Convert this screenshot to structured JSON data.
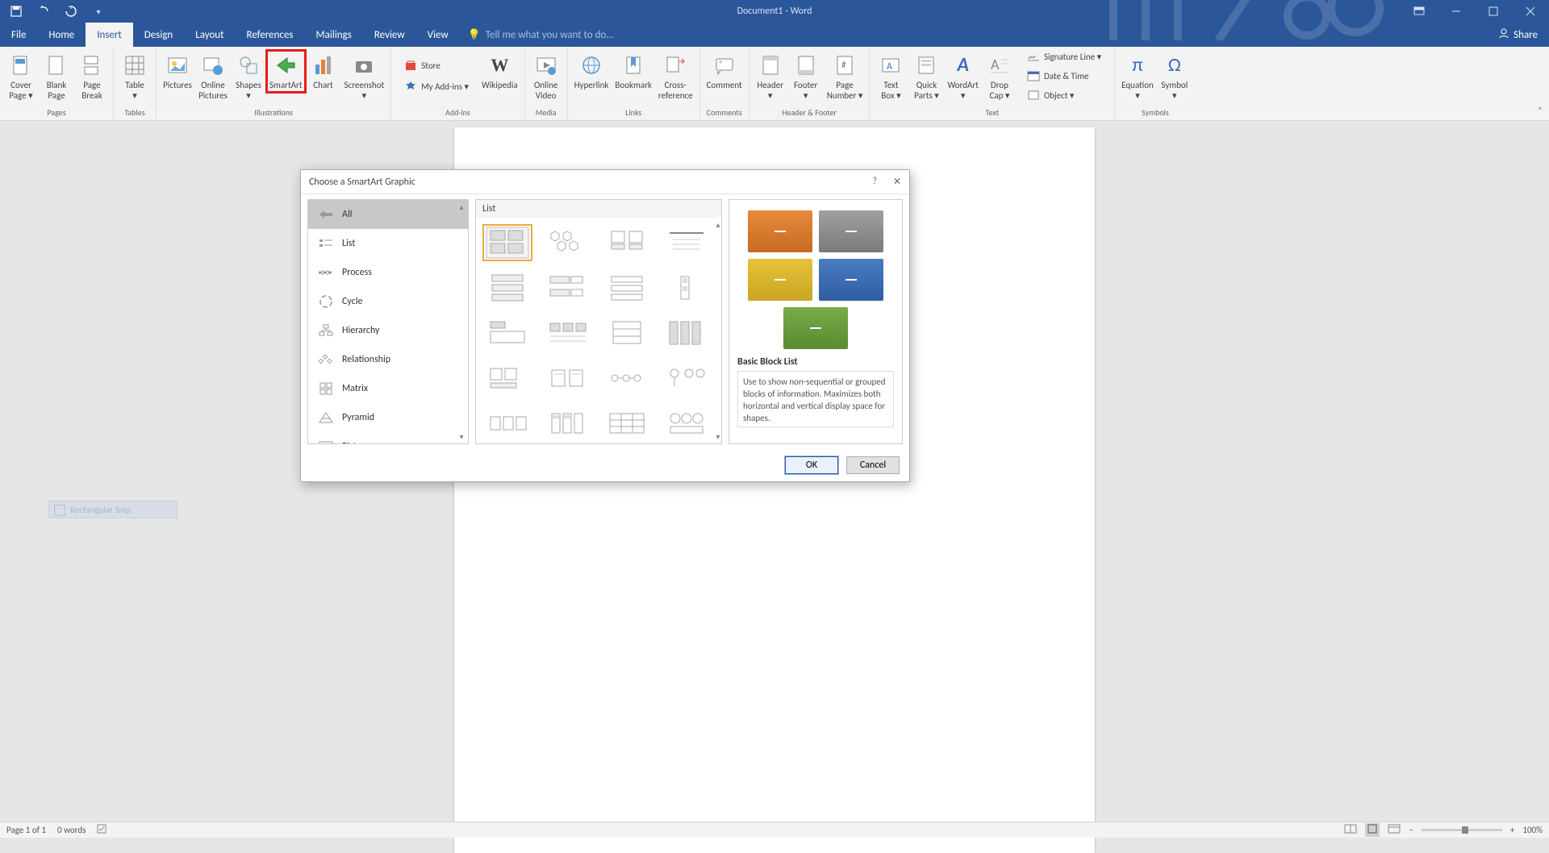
{
  "title_bar": {
    "doc_title": "Document1 - Word"
  },
  "tabs": {
    "file": "File",
    "home": "Home",
    "insert": "Insert",
    "design": "Design",
    "layout": "Layout",
    "references": "References",
    "mailings": "Mailings",
    "review": "Review",
    "view": "View"
  },
  "tell_me": "Tell me what you want to do...",
  "share": "Share",
  "ribbon": {
    "groups": {
      "pages": "Pages",
      "tables": "Tables",
      "illustrations": "Illustrations",
      "addins": "Add-ins",
      "media": "Media",
      "links": "Links",
      "comments": "Comments",
      "header_footer": "Header & Footer",
      "text": "Text",
      "symbols": "Symbols"
    },
    "buttons": {
      "cover_page": "Cover\nPage ▾",
      "blank_page": "Blank\nPage",
      "page_break": "Page\nBreak",
      "table": "Table\n▾",
      "pictures": "Pictures",
      "online_pictures": "Online\nPictures",
      "shapes": "Shapes\n▾",
      "smartart": "SmartArt",
      "chart": "Chart",
      "screenshot": "Screenshot\n▾",
      "store": "Store",
      "my_addins": "My Add-ins ▾",
      "wikipedia": "Wikipedia",
      "online_video": "Online\nVideo",
      "hyperlink": "Hyperlink",
      "bookmark": "Bookmark",
      "cross_ref": "Cross-\nreference",
      "comment": "Comment",
      "header": "Header\n▾",
      "footer": "Footer\n▾",
      "page_number": "Page\nNumber ▾",
      "text_box": "Text\nBox ▾",
      "quick_parts": "Quick\nParts ▾",
      "wordart": "WordArt\n▾",
      "drop_cap": "Drop\nCap ▾",
      "signature": "Signature Line  ▾",
      "datetime": "Date & Time",
      "object": "Object  ▾",
      "equation": "Equation\n▾",
      "symbol": "Symbol\n▾"
    }
  },
  "dialog": {
    "title": "Choose a SmartArt Graphic",
    "help": "?",
    "categories": [
      "All",
      "List",
      "Process",
      "Cycle",
      "Hierarchy",
      "Relationship",
      "Matrix",
      "Pyramid",
      "Picture"
    ],
    "gallery_header": "List",
    "preview_title": "Basic Block List",
    "preview_desc": "Use to show non-sequential or grouped blocks of information. Maximizes both horizontal and vertical display space for shapes.",
    "ok": "OK",
    "cancel": "Cancel",
    "preview_colors": [
      "#d97a2e",
      "#8d8d8d",
      "#d6b62f",
      "#3d6fb5",
      "#6a9a3d"
    ]
  },
  "status_bar": {
    "page": "Page 1 of 1",
    "words": "0 words",
    "zoom": "100%"
  },
  "snip_label": "Rectangular Snip"
}
